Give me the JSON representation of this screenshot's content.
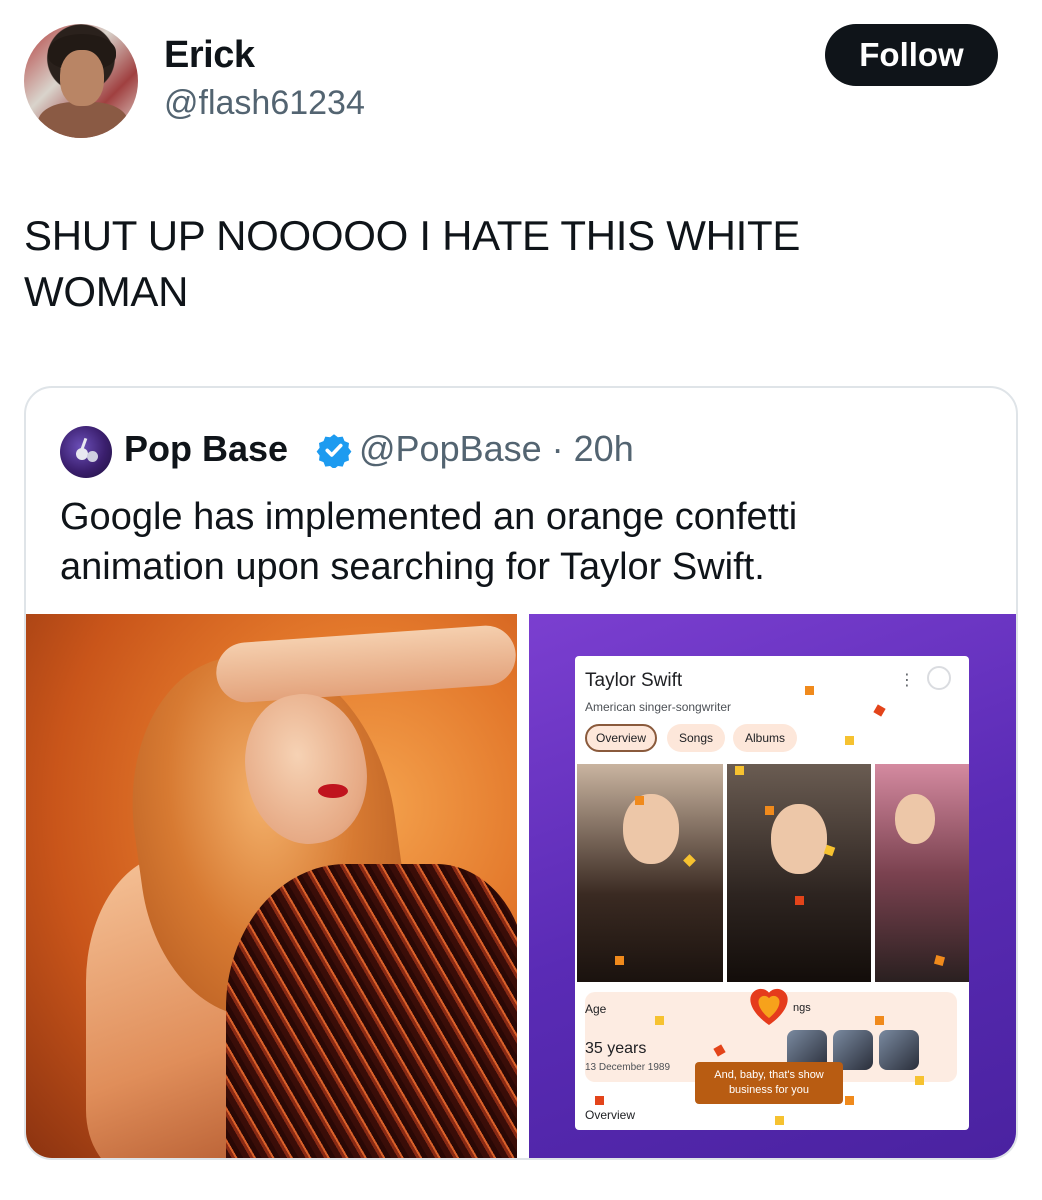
{
  "author": {
    "name": "Erick",
    "handle": "@flash61234",
    "avatar_icon": "user-avatar-photo"
  },
  "follow_button": {
    "label": "Follow",
    "color": "#0f1419"
  },
  "tweet_text": "SHUT UP NOOOOO I HATE THIS WHITE WOMAN",
  "quoted_tweet": {
    "name": "Pop Base",
    "verified_icon": "verified-badge-icon",
    "verified_color": "#1d9bf0",
    "handle_time": "@PopBase · 20h",
    "text": "Google has implemented an orange confetti animation upon searching for Taylor Swift.",
    "screenshot": {
      "title": "Taylor Swift",
      "subtitle": "American singer-songwriter",
      "tabs": [
        "Overview",
        "Songs",
        "Albums"
      ],
      "age_label": "Age",
      "age_value": "35 years",
      "birth_date": "13 December 1989",
      "songs_label": "ngs",
      "toast_line1": "And, baby, that's show",
      "toast_line2": "business for you",
      "overview_label": "Overview"
    }
  }
}
